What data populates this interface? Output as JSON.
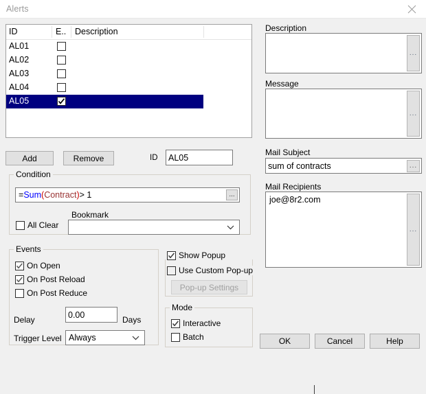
{
  "window": {
    "title": "Alerts",
    "close_icon": "close-icon"
  },
  "alert_list": {
    "columns": [
      "ID",
      "E..",
      "Description",
      ""
    ],
    "rows": [
      {
        "id": "AL01",
        "enabled": false,
        "description": "",
        "selected": false
      },
      {
        "id": "AL02",
        "enabled": false,
        "description": "",
        "selected": false
      },
      {
        "id": "AL03",
        "enabled": false,
        "description": "",
        "selected": false
      },
      {
        "id": "AL04",
        "enabled": false,
        "description": "",
        "selected": false
      },
      {
        "id": "AL05",
        "enabled": true,
        "description": "",
        "selected": true
      }
    ]
  },
  "buttons": {
    "add": "Add",
    "remove": "Remove",
    "ok": "OK",
    "cancel": "Cancel",
    "help": "Help",
    "popup_settings": "Pop-up Settings",
    "ellipsis": "..."
  },
  "id_field": {
    "label": "ID",
    "value": "AL05"
  },
  "condition": {
    "group_title": "Condition",
    "expression_tokens": [
      {
        "text": "=",
        "type": "operator"
      },
      {
        "text": "Sum",
        "type": "function"
      },
      {
        "text": "(",
        "type": "paren"
      },
      {
        "text": "Contract",
        "type": "field"
      },
      {
        "text": ")",
        "type": "paren"
      },
      {
        "text": "> 1",
        "type": "operator"
      }
    ],
    "expression_plain": "=Sum(Contract)> 1",
    "all_clear_label": "All Clear",
    "all_clear_checked": false,
    "bookmark_label": "Bookmark",
    "bookmark_value": ""
  },
  "events": {
    "group_title": "Events",
    "checkboxes": [
      {
        "label": "On Open",
        "checked": true
      },
      {
        "label": "On Post Reload",
        "checked": true
      },
      {
        "label": "On Post Reduce",
        "checked": false
      }
    ],
    "delay_label": "Delay",
    "delay_value": "0.00",
    "days_label": "Days",
    "trigger_level_label": "Trigger Level",
    "trigger_level_value": "Always"
  },
  "popup": {
    "show_popup_label": "Show Popup",
    "show_popup_checked": true,
    "use_custom_label": "Use Custom Pop-up",
    "use_custom_checked": false,
    "settings_button_disabled": true
  },
  "mode": {
    "group_title": "Mode",
    "options": [
      {
        "label": "Interactive",
        "checked": true
      },
      {
        "label": "Batch",
        "checked": false
      }
    ]
  },
  "right_panel": {
    "description_label": "Description",
    "description_value": "",
    "message_label": "Message",
    "message_value": "",
    "mail_subject_label": "Mail Subject",
    "mail_subject_value": "sum of contracts",
    "mail_recipients_label": "Mail Recipients",
    "mail_recipients_value": "joe@8r2.com"
  },
  "colors": {
    "selection": "#000080",
    "dialog_bg": "#f0f0f0",
    "field_bg": "#ffffff",
    "function_token": "#0000ff",
    "field_token": "#993333"
  }
}
